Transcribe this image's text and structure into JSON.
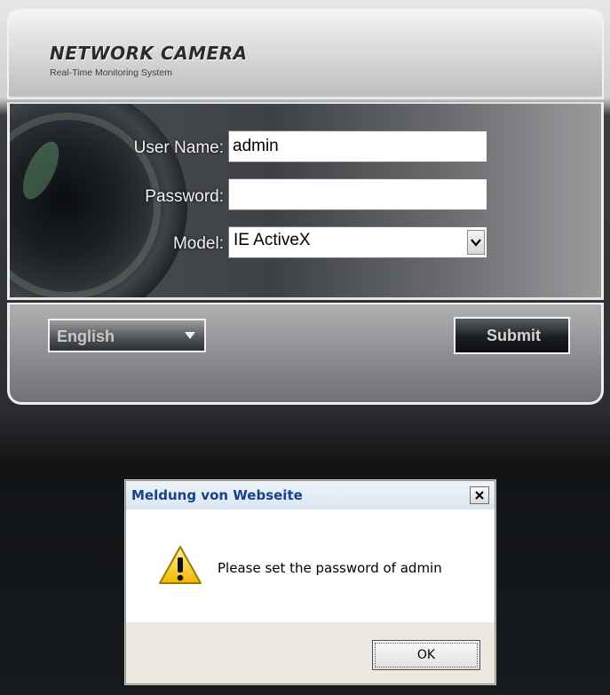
{
  "header": {
    "title": "NETWORK CAMERA",
    "subtitle": "Real-Time Monitoring System"
  },
  "login": {
    "username_label": "User Name:",
    "username_value": "admin",
    "password_label": "Password:",
    "password_value": "",
    "model_label": "Model:",
    "model_value": "IE ActiveX"
  },
  "bottom": {
    "language_value": "English",
    "submit_label": "Submit"
  },
  "dialog": {
    "title": "Meldung von Webseite",
    "close_label": "X",
    "message": "Please set the password of admin",
    "ok_label": "OK"
  },
  "colors": {
    "dialog_title_text": "#15428b",
    "warning_yellow": "#f5c400"
  },
  "icons": {
    "lens": "camera-lens-icon",
    "select_arrow": "chevron-down-icon",
    "language_arrow": "triangle-down-icon",
    "warning": "warning-icon",
    "close": "close-icon"
  }
}
